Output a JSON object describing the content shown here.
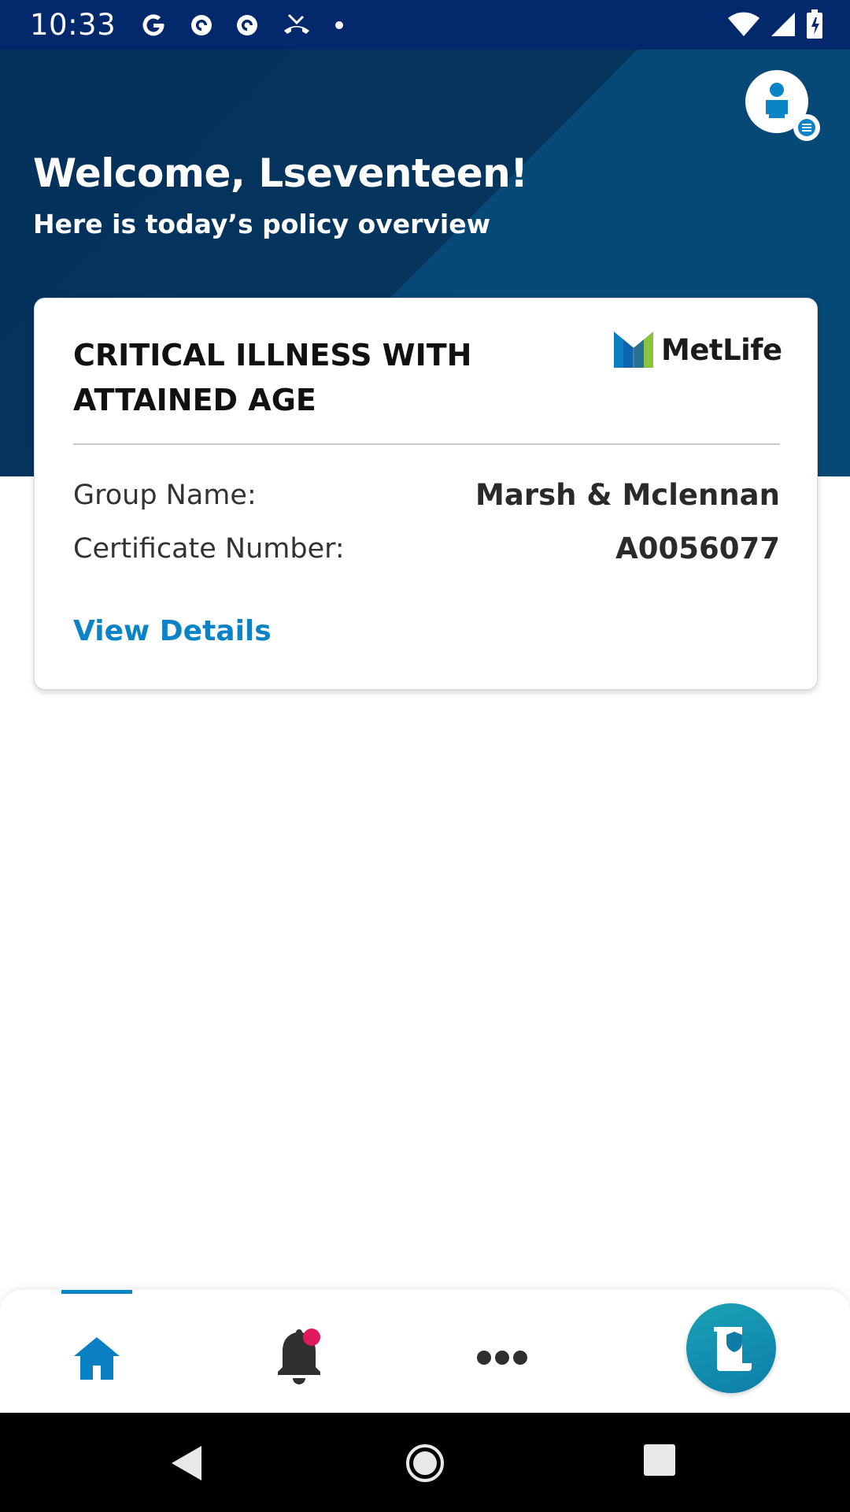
{
  "status_bar": {
    "time": "10:33",
    "icons": [
      "google-icon",
      "pocket-casts-icon",
      "pocket-casts-icon",
      "missed-call-icon",
      "dot-icon",
      "wifi-icon",
      "signal-icon",
      "battery-icon"
    ]
  },
  "header": {
    "welcome": "Welcome, Lseventeen!",
    "subtitle": "Here is today’s policy overview"
  },
  "policy_card": {
    "title": "CRITICAL ILLNESS WITH ATTAINED AGE",
    "brand": "MetLife",
    "rows": [
      {
        "label": "Group Name:",
        "value": "Marsh & Mclennan"
      },
      {
        "label": "Certificate Number:",
        "value": "A0056077"
      }
    ],
    "link": "View Details"
  },
  "bottom_nav": {
    "active": "home",
    "items": [
      "home-icon",
      "bell-icon",
      "more-icon",
      "claims-icon"
    ]
  },
  "colors": {
    "header_bg": "#04315c",
    "status_bg": "#03286b",
    "accent": "#0a84c6",
    "fab": "#1aa2b6",
    "notification_dot": "#e0195a"
  }
}
